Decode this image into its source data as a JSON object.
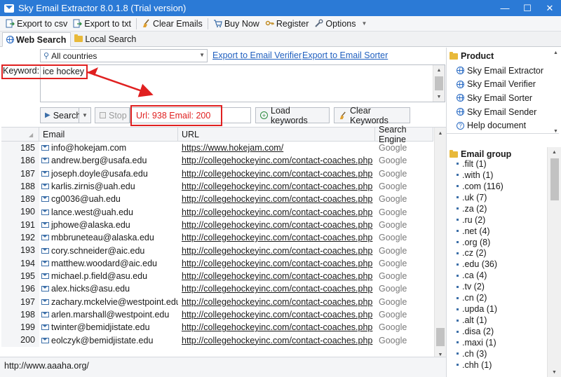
{
  "window": {
    "title": "Sky Email Extractor 8.0.1.8 (Trial version)",
    "minimize": "—",
    "maximize": "☐",
    "close": "✕"
  },
  "toolbar": {
    "export_csv": "Export to csv",
    "export_txt": "Export to txt",
    "clear_emails": "Clear Emails",
    "buy_now": "Buy Now",
    "register": "Register",
    "options": "Options"
  },
  "tabs": [
    {
      "label": "Web Search"
    },
    {
      "label": "Local Search"
    }
  ],
  "search": {
    "country": "All countries",
    "export_verifier": "Export to Email Verifier",
    "export_sorter": "Export to Email Sorter",
    "keyword_label": "Keyword:",
    "keyword_value": "ice hockey",
    "search_btn": "Search",
    "stop_btn": "Stop",
    "status": "Url: 938 Email: 200",
    "load_keywords": "Load keywords",
    "clear_keywords": "Clear Keywords"
  },
  "grid": {
    "headers": [
      "Email",
      "URL",
      "Search Engine"
    ],
    "rows": [
      {
        "n": "185",
        "email": "info@hokejam.com",
        "url": "https://www.hokejam.com/",
        "engine": "Google"
      },
      {
        "n": "186",
        "email": "andrew.berg@usafa.edu",
        "url": "http://collegehockeyinc.com/contact-coaches.php",
        "engine": "Google"
      },
      {
        "n": "187",
        "email": "joseph.doyle@usafa.edu",
        "url": "http://collegehockeyinc.com/contact-coaches.php",
        "engine": "Google"
      },
      {
        "n": "188",
        "email": "karlis.zirnis@uah.edu",
        "url": "http://collegehockeyinc.com/contact-coaches.php",
        "engine": "Google"
      },
      {
        "n": "189",
        "email": "cg0036@uah.edu",
        "url": "http://collegehockeyinc.com/contact-coaches.php",
        "engine": "Google"
      },
      {
        "n": "190",
        "email": "lance.west@uah.edu",
        "url": "http://collegehockeyinc.com/contact-coaches.php",
        "engine": "Google"
      },
      {
        "n": "191",
        "email": "jphowe@alaska.edu",
        "url": "http://collegehockeyinc.com/contact-coaches.php",
        "engine": "Google"
      },
      {
        "n": "192",
        "email": "mbbruneteau@alaska.edu",
        "url": "http://collegehockeyinc.com/contact-coaches.php",
        "engine": "Google"
      },
      {
        "n": "193",
        "email": "cory.schneider@aic.edu",
        "url": "http://collegehockeyinc.com/contact-coaches.php",
        "engine": "Google"
      },
      {
        "n": "194",
        "email": "matthew.woodard@aic.edu",
        "url": "http://collegehockeyinc.com/contact-coaches.php",
        "engine": "Google"
      },
      {
        "n": "195",
        "email": "michael.p.field@asu.edu",
        "url": "http://collegehockeyinc.com/contact-coaches.php",
        "engine": "Google"
      },
      {
        "n": "196",
        "email": "alex.hicks@asu.edu",
        "url": "http://collegehockeyinc.com/contact-coaches.php",
        "engine": "Google"
      },
      {
        "n": "197",
        "email": "zachary.mckelvie@westpoint.edu",
        "url": "http://collegehockeyinc.com/contact-coaches.php",
        "engine": "Google"
      },
      {
        "n": "198",
        "email": "arlen.marshall@westpoint.edu",
        "url": "http://collegehockeyinc.com/contact-coaches.php",
        "engine": "Google"
      },
      {
        "n": "199",
        "email": "twinter@bemidjistate.edu",
        "url": "http://collegehockeyinc.com/contact-coaches.php",
        "engine": "Google"
      },
      {
        "n": "200",
        "email": "eolczyk@bemidjistate.edu",
        "url": "http://collegehockeyinc.com/contact-coaches.php",
        "engine": "Google"
      }
    ]
  },
  "statusbar": {
    "text": "http://www.aaaha.org/"
  },
  "product": {
    "title": "Product",
    "items": [
      "Sky Email Extractor",
      "Sky Email Verifier",
      "Sky Email Sorter",
      "Sky Email Sender",
      "Help document"
    ]
  },
  "email_group": {
    "title": "Email group",
    "items": [
      ".filt (1)",
      ".with (1)",
      ".com (116)",
      ".uk (7)",
      ".za (2)",
      ".ru (2)",
      ".net (4)",
      ".org (8)",
      ".cz (2)",
      ".edu (36)",
      ".ca (4)",
      ".tv (2)",
      ".cn (2)",
      ".upda (1)",
      ".alt (1)",
      ".disa (2)",
      ".maxi (1)",
      ".ch (3)",
      ".chh (1)"
    ]
  },
  "colors": {
    "titlebar": "#2b7ad6",
    "annotation_red": "#e02020",
    "link_blue": "#1f5fbf"
  }
}
